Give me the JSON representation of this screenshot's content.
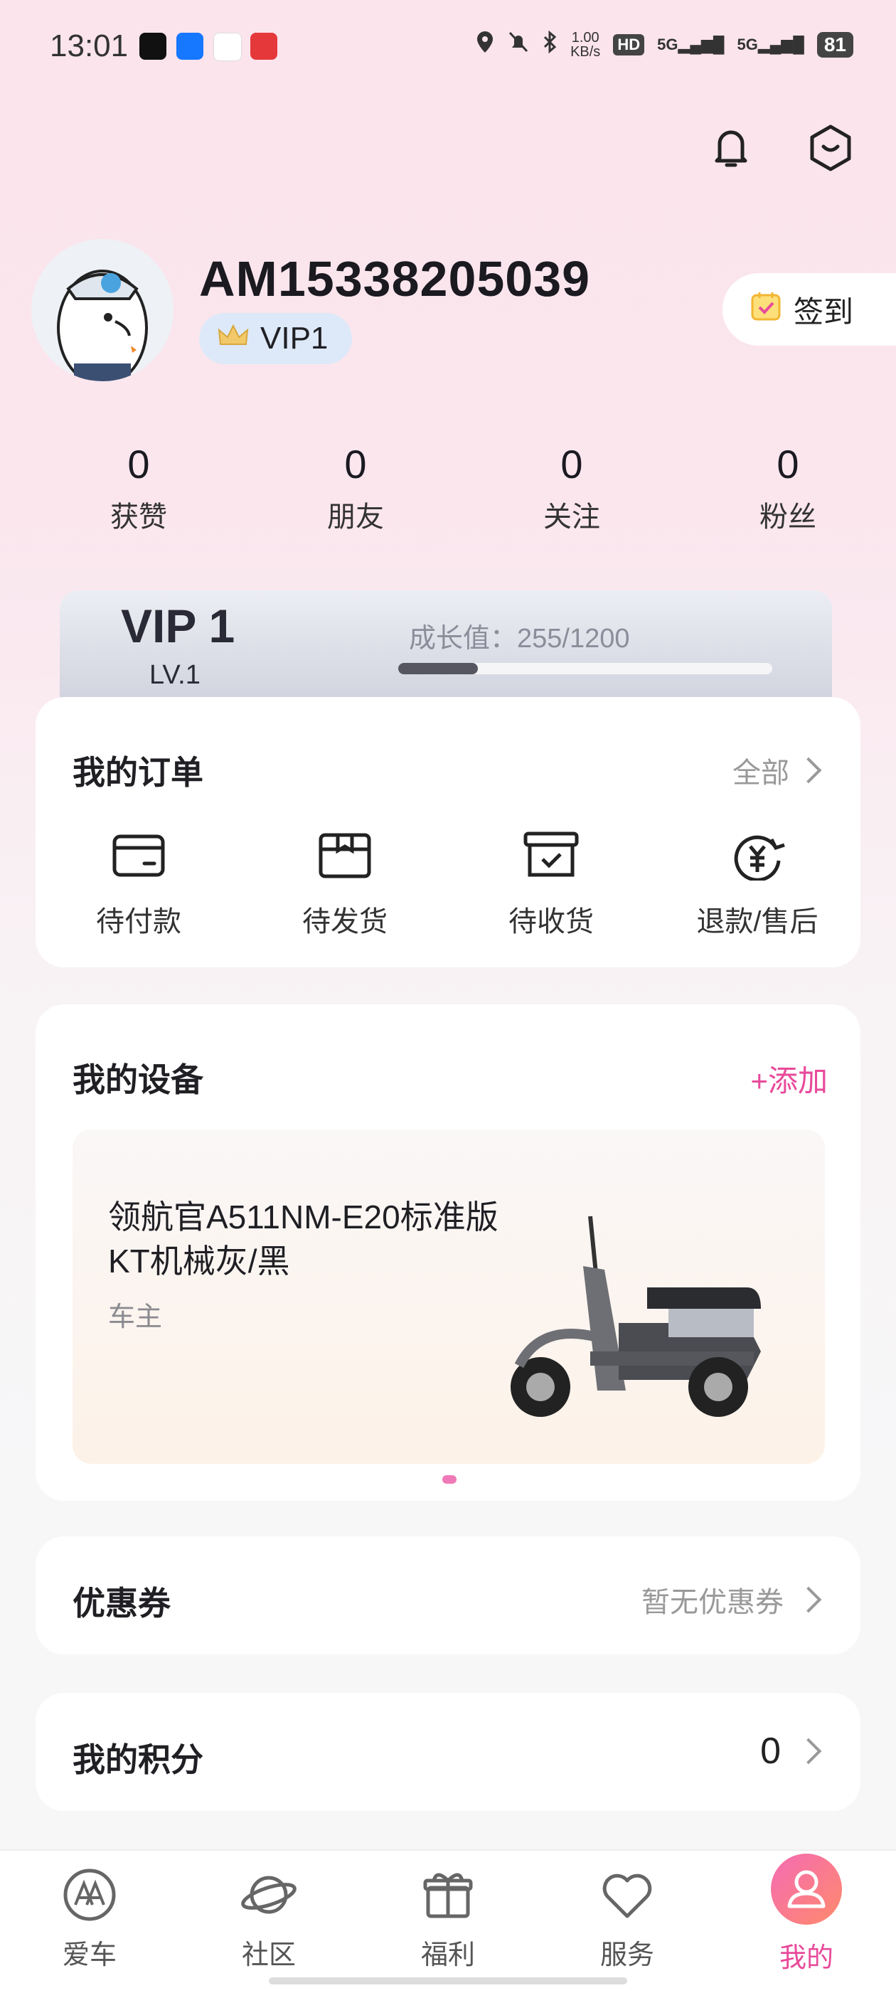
{
  "status_bar": {
    "time": "13:01",
    "speed_value": "1.00",
    "speed_unit": "KB/s",
    "hd": "HD",
    "net1": "5G",
    "net2": "5G",
    "battery": "81"
  },
  "profile": {
    "username": "AM15338205039",
    "vip_badge": "VIP1",
    "checkin_label": "签到"
  },
  "stats": [
    {
      "value": "0",
      "label": "获赞"
    },
    {
      "value": "0",
      "label": "朋友"
    },
    {
      "value": "0",
      "label": "关注"
    },
    {
      "value": "0",
      "label": "粉丝"
    }
  ],
  "vip_card": {
    "title": "VIP 1",
    "level": "LV.1",
    "growth_label": "成长值：255/1200",
    "progress": 0.2125
  },
  "orders": {
    "title": "我的订单",
    "all_label": "全部",
    "items": [
      {
        "label": "待付款",
        "icon": "wallet-icon"
      },
      {
        "label": "待发货",
        "icon": "package-icon"
      },
      {
        "label": "待收货",
        "icon": "box-check-icon"
      },
      {
        "label": "退款/售后",
        "icon": "refund-icon"
      }
    ]
  },
  "devices": {
    "title": "我的设备",
    "add_label": "+添加",
    "device_name_line1": "领航官A511NM-E20标准版",
    "device_name_line2": "KT机械灰/黑",
    "device_role": "车主"
  },
  "coupons": {
    "title": "优惠券",
    "value": "暂无优惠券"
  },
  "points": {
    "title": "我的积分",
    "value": "0"
  },
  "tabs": [
    {
      "label": "爱车",
      "icon": "car-logo-icon"
    },
    {
      "label": "社区",
      "icon": "planet-icon"
    },
    {
      "label": "福利",
      "icon": "gift-icon"
    },
    {
      "label": "服务",
      "icon": "heart-icon"
    },
    {
      "label": "我的",
      "icon": "user-icon",
      "active": true
    }
  ],
  "colors": {
    "accent": "#e84a9a",
    "background_top": "#fbe4ec",
    "vip_pill": "#dde9f8"
  }
}
